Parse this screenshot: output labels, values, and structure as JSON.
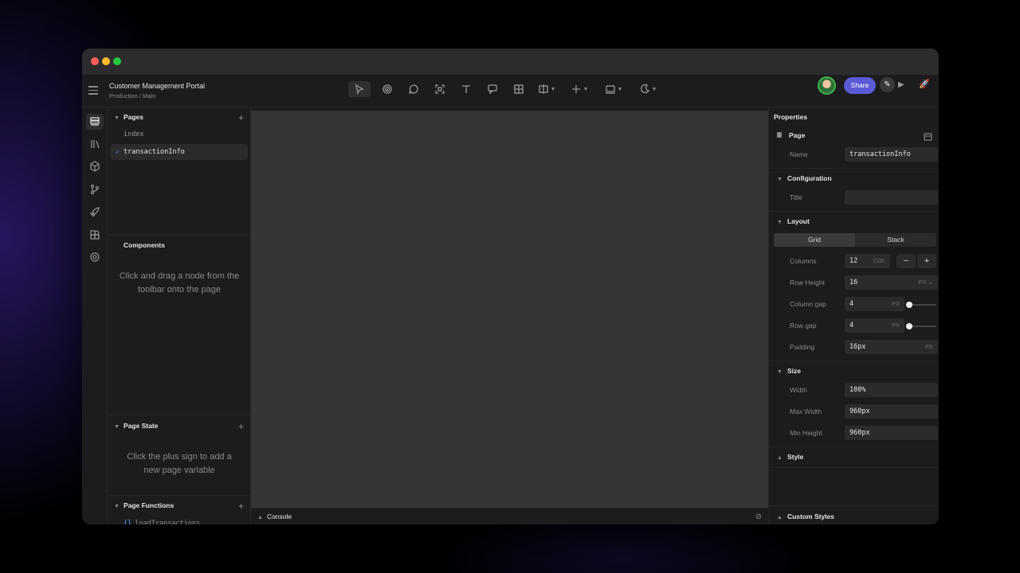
{
  "project": {
    "title": "Customer Management Portal",
    "breadcrumb": "Production / Main"
  },
  "toolbar": {
    "share_label": "Share",
    "tools": [
      "pointer-icon",
      "fingerprint-icon",
      "comment-icon",
      "frame-select-icon",
      "text-icon",
      "comment-add-icon",
      "table-icon",
      "layout-icon",
      "plus-icon",
      "device-icon",
      "theme-icon"
    ]
  },
  "left": {
    "pages_header": "Pages",
    "pages": [
      {
        "label": "index"
      },
      {
        "label": "transactionInfo",
        "selected": true
      }
    ],
    "components_header": "Components",
    "components_hint": "Click and drag a node from the toolbar onto the page",
    "page_state_header": "Page State",
    "page_state_hint": "Click the plus sign to add a new page variable",
    "page_functions_header": "Page Functions",
    "functions": [
      {
        "label": "loadTransactions"
      }
    ]
  },
  "console": {
    "label": "Console"
  },
  "properties": {
    "title": "Properties",
    "page_section": "Page",
    "name_label": "Name",
    "name_value": "transactionInfo",
    "configuration_section": "Configuration",
    "title_label": "Title",
    "title_value": "",
    "layout_section": "Layout",
    "layout_modes": [
      "Grid",
      "Stack"
    ],
    "layout_selected": "Grid",
    "columns_label": "Columns",
    "columns_value": "12",
    "columns_unit": "COL",
    "row_height_label": "Row Height",
    "row_height_value": "16",
    "row_height_unit": "PX",
    "column_gap_label": "Column gap",
    "column_gap_value": "4",
    "column_gap_unit": "PX",
    "row_gap_label": "Row gap",
    "row_gap_value": "4",
    "row_gap_unit": "PX",
    "padding_label": "Padding",
    "padding_value": "16px",
    "padding_unit": "PX",
    "size_section": "Size",
    "width_label": "Width",
    "width_value": "100%",
    "max_width_label": "Max Width",
    "max_width_value": "960px",
    "min_height_label": "Min Height",
    "min_height_value": "960px",
    "style_section": "Style",
    "custom_styles_section": "Custom Styles"
  },
  "colors": {
    "accent": "#5b5bd6",
    "canvas": "#353538",
    "panel": "#1c1c1e"
  }
}
